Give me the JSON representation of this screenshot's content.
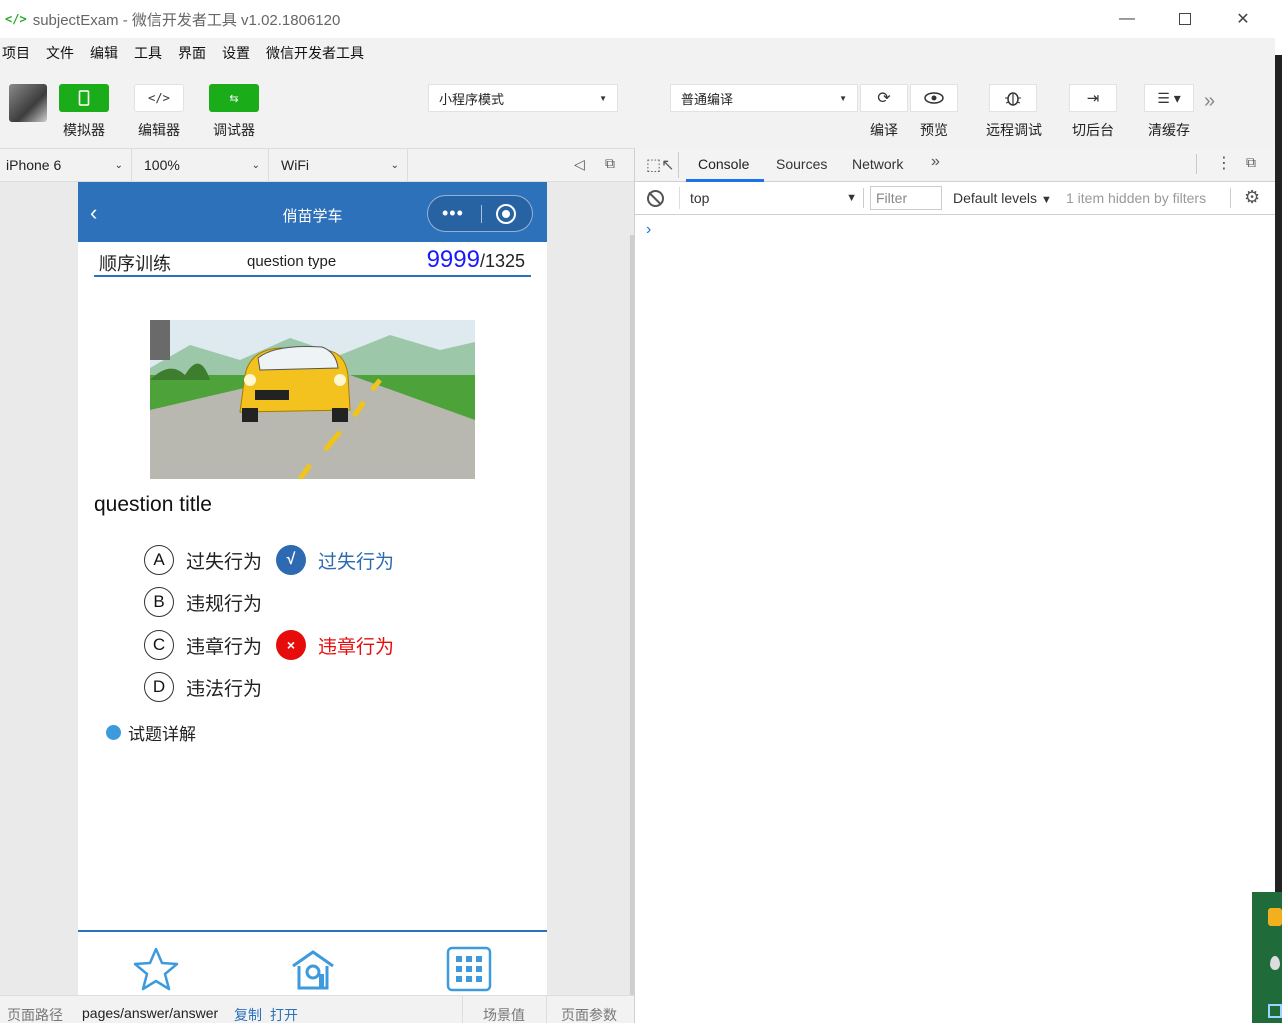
{
  "window": {
    "title": "subjectExam - 微信开发者工具 v1.02.1806120",
    "app_icon": "</>"
  },
  "menu": [
    "项目",
    "文件",
    "编辑",
    "工具",
    "界面",
    "设置",
    "微信开发者工具"
  ],
  "toolbar": {
    "simulator_label": "模拟器",
    "editor_label": "编辑器",
    "debugger_label": "调试器",
    "mode_select": "小程序模式",
    "compile_select": "普通编译",
    "compile_label": "编译",
    "preview_label": "预览",
    "remote_debug_label": "远程调试",
    "background_label": "切后台",
    "clear_cache_label": "清缓存",
    "active_color": "#1aad19"
  },
  "device": {
    "model": "iPhone 6",
    "zoom": "100%",
    "network": "WiFi"
  },
  "app": {
    "nav_title": "俏苗学车",
    "mode": "顺序训练",
    "question_type": "question type",
    "current": "9999",
    "total": "/1325",
    "question_title": "question title",
    "options": [
      {
        "letter": "A",
        "text": "过失行为",
        "mark": "√",
        "mark_text": "过失行为"
      },
      {
        "letter": "B",
        "text": "违规行为"
      },
      {
        "letter": "C",
        "text": "违章行为",
        "mark": "×",
        "mark_text": "违章行为"
      },
      {
        "letter": "D",
        "text": "违法行为"
      }
    ],
    "explain": "试题详解",
    "theme_color": "#2d71ba",
    "correct_color": "#2d6ab1",
    "wrong_color": "#e60c0c"
  },
  "statusbar": {
    "path_label": "页面路径",
    "path": "pages/answer/answer",
    "copy": "复制",
    "open": "打开",
    "scene_label": "场景值",
    "params_label": "页面参数"
  },
  "devtools": {
    "tabs": [
      "Console",
      "Sources",
      "Network"
    ],
    "active_tab": "Console",
    "context": "top",
    "filter_placeholder": "Filter",
    "levels": "Default levels",
    "hidden_info": "1 item hidden by filters",
    "prompt": "›"
  }
}
